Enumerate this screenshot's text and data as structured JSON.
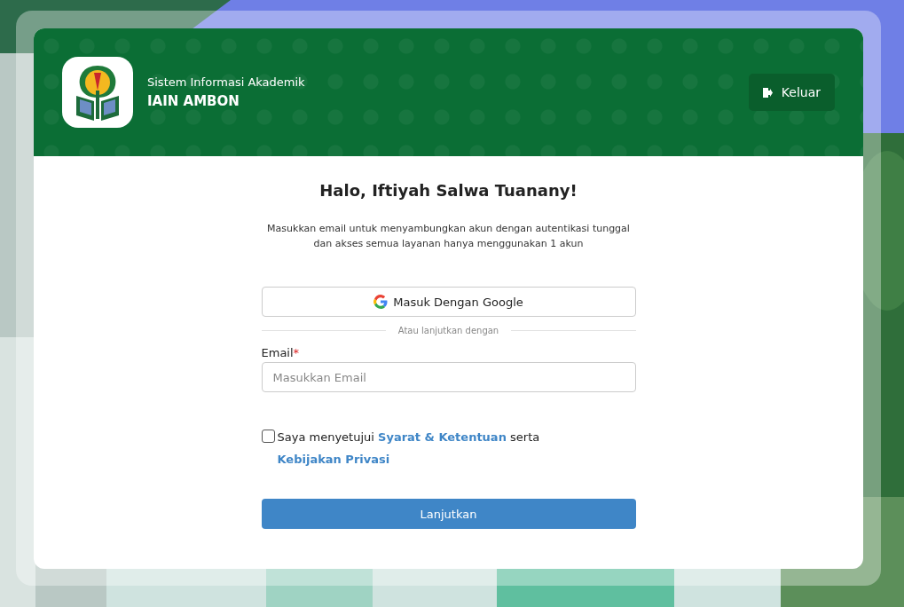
{
  "header": {
    "subtitle": "Sistem Informasi Akademik",
    "title": "IAIN AMBON",
    "logout_button": "Keluar"
  },
  "greeting": "Halo, Iftiyah Salwa Tuanany!",
  "description": "Masukkan email untuk menyambungkan akun dengan autentikasi tunggal dan akses semua layanan hanya menggunakan 1 akun",
  "google_button": "Masuk Dengan Google",
  "divider": "Atau lanjutkan dengan",
  "email": {
    "label": "Email",
    "required_mark": "*",
    "placeholder": "Masukkan Email"
  },
  "agreement": {
    "checked": false,
    "parts": [
      {
        "kind": "text",
        "text": "Saya menyetujui "
      },
      {
        "kind": "link",
        "text": "Syarat & Ketentuan"
      },
      {
        "kind": "text",
        "text": " serta "
      },
      {
        "kind": "link",
        "text": "Kebijakan Privasi"
      }
    ]
  },
  "submit_button": "Lanjutkan"
}
